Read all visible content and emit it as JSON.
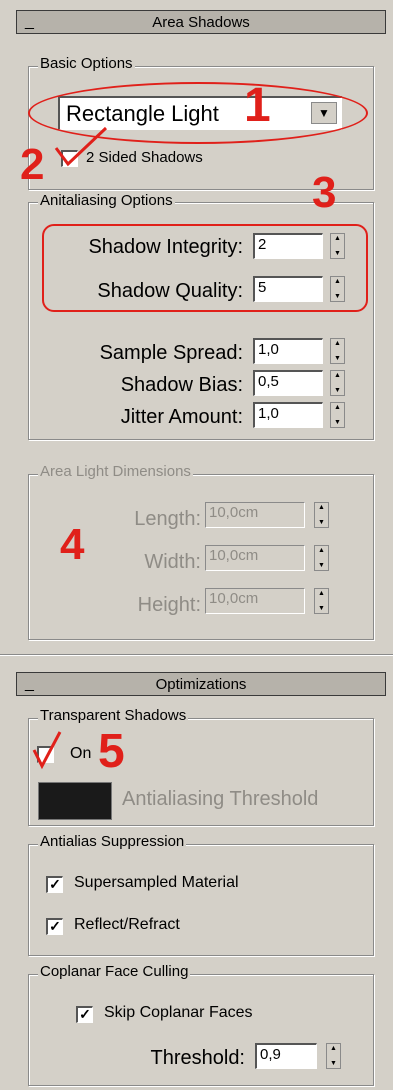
{
  "area_shadows": {
    "header": {
      "collapse": "_",
      "title": "Area Shadows"
    },
    "basic_options": {
      "title": "Basic Options",
      "light_type": "Rectangle Light",
      "two_sided_label": "2 Sided Shadows"
    },
    "antialiasing": {
      "title": "Anitaliasing Options",
      "shadow_integrity_label": "Shadow Integrity:",
      "shadow_integrity": "2",
      "shadow_quality_label": "Shadow Quality:",
      "shadow_quality": "5",
      "sample_spread_label": "Sample Spread:",
      "sample_spread": "1,0",
      "shadow_bias_label": "Shadow Bias:",
      "shadow_bias": "0,5",
      "jitter_amount_label": "Jitter Amount:",
      "jitter_amount": "1,0"
    },
    "dimensions": {
      "title": "Area Light Dimensions",
      "length_label": "Length:",
      "length": "10,0cm",
      "width_label": "Width:",
      "width": "10,0cm",
      "height_label": "Height:",
      "height": "10,0cm"
    }
  },
  "optimizations": {
    "header": {
      "collapse": "_",
      "title": "Optimizations"
    },
    "transparent_shadows": {
      "title": "Transparent Shadows",
      "on_label": "On",
      "threshold_label": "Antialiasing Threshold"
    },
    "suppression": {
      "title": "Antialias Suppression",
      "supersampled_label": "Supersampled Material",
      "reflect_label": "Reflect/Refract"
    },
    "coplanar": {
      "title": "Coplanar Face Culling",
      "skip_label": "Skip Coplanar Faces",
      "threshold_label": "Threshold:",
      "threshold": "0,9"
    }
  },
  "annotations": [
    "1",
    "2",
    "3",
    "4",
    "5"
  ],
  "colors": {
    "panel": "#d4d0c8",
    "annotation": "#e0201a",
    "swatch": "#1a1a1a"
  }
}
